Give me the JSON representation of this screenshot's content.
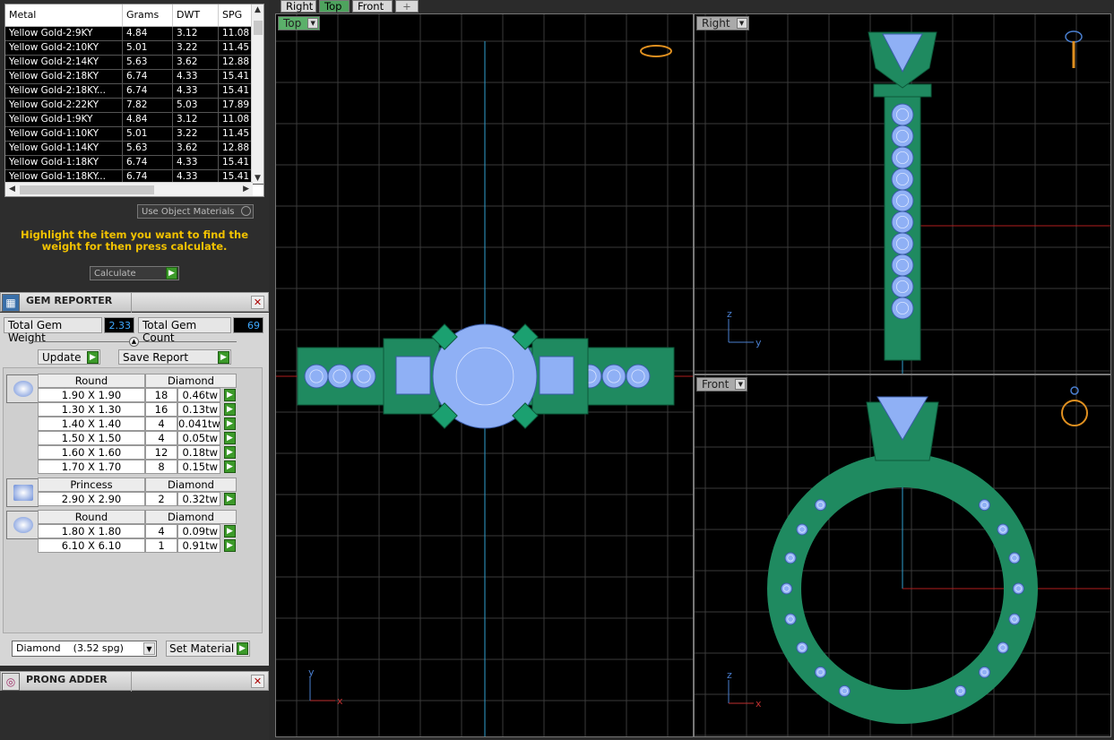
{
  "metal_table": {
    "columns": [
      "Metal",
      "Grams",
      "DWT",
      "SPG"
    ],
    "rows": [
      [
        "Yellow Gold-2:9KY",
        "4.84",
        "3.12",
        "11.08"
      ],
      [
        "Yellow Gold-2:10KY",
        "5.01",
        "3.22",
        "11.45"
      ],
      [
        "Yellow Gold-2:14KY",
        "5.63",
        "3.62",
        "12.88"
      ],
      [
        "Yellow Gold-2:18KY",
        "6.74",
        "4.33",
        "15.41"
      ],
      [
        "Yellow Gold-2:18KY...",
        "6.74",
        "4.33",
        "15.41"
      ],
      [
        "Yellow Gold-2:22KY",
        "7.82",
        "5.03",
        "17.89"
      ],
      [
        "Yellow Gold-1:9KY",
        "4.84",
        "3.12",
        "11.08"
      ],
      [
        "Yellow Gold-1:10KY",
        "5.01",
        "3.22",
        "11.45"
      ],
      [
        "Yellow Gold-1:14KY",
        "5.63",
        "3.62",
        "12.88"
      ],
      [
        "Yellow Gold-1:18KY",
        "6.74",
        "4.33",
        "15.41"
      ],
      [
        "Yellow Gold-1:18KY...",
        "6.74",
        "4.33",
        "15.41"
      ]
    ]
  },
  "use_object_materials": "Use Object Materials",
  "hint": "Highlight the item you want to find the weight for then press calculate.",
  "calculate_label": "Calculate",
  "gem_reporter": {
    "title": "GEM REPORTER",
    "total_weight_label": "Total Gem Weight",
    "total_weight_value": "2.33",
    "total_count_label": "Total Gem Count",
    "total_count_value": "69",
    "update_label": "Update",
    "save_report_label": "Save Report",
    "groups": [
      {
        "shape": "Round",
        "material": "Diamond",
        "rows": [
          [
            "1.90 X 1.90",
            "18",
            "0.46tw"
          ],
          [
            "1.30 X 1.30",
            "16",
            "0.13tw"
          ],
          [
            "1.40 X 1.40",
            "4",
            "0.041tw"
          ],
          [
            "1.50 X 1.50",
            "4",
            "0.05tw"
          ],
          [
            "1.60 X 1.60",
            "12",
            "0.18tw"
          ],
          [
            "1.70 X 1.70",
            "8",
            "0.15tw"
          ]
        ]
      },
      {
        "shape": "Princess",
        "material": "Diamond",
        "rows": [
          [
            "2.90 X 2.90",
            "2",
            "0.32tw"
          ]
        ]
      },
      {
        "shape": "Round",
        "material": "Diamond",
        "rows": [
          [
            "1.80 X 1.80",
            "4",
            "0.09tw"
          ],
          [
            "6.10 X 6.10",
            "1",
            "0.91tw"
          ]
        ]
      }
    ],
    "material_select": "Diamond    (3.52 spg)",
    "set_material_label": "Set Material"
  },
  "prong_adder": {
    "title": "PRONG ADDER"
  },
  "tabs": [
    "Right",
    "Top",
    "Front",
    "+"
  ],
  "active_tab": "Top",
  "viewports": {
    "top": {
      "label": "Top",
      "axis_v": "y",
      "axis_h": "x"
    },
    "right": {
      "label": "Right",
      "axis_v": "z",
      "axis_h": "y"
    },
    "front": {
      "label": "Front",
      "axis_v": "z",
      "axis_h": "x"
    }
  },
  "colors": {
    "metal": "#1f8a60",
    "gem": "#8fb0f5",
    "grid": "#3a3a3a",
    "axis_blue": "#2fa0d0",
    "axis_red": "#b01e1e",
    "hint": "#f2c200"
  }
}
